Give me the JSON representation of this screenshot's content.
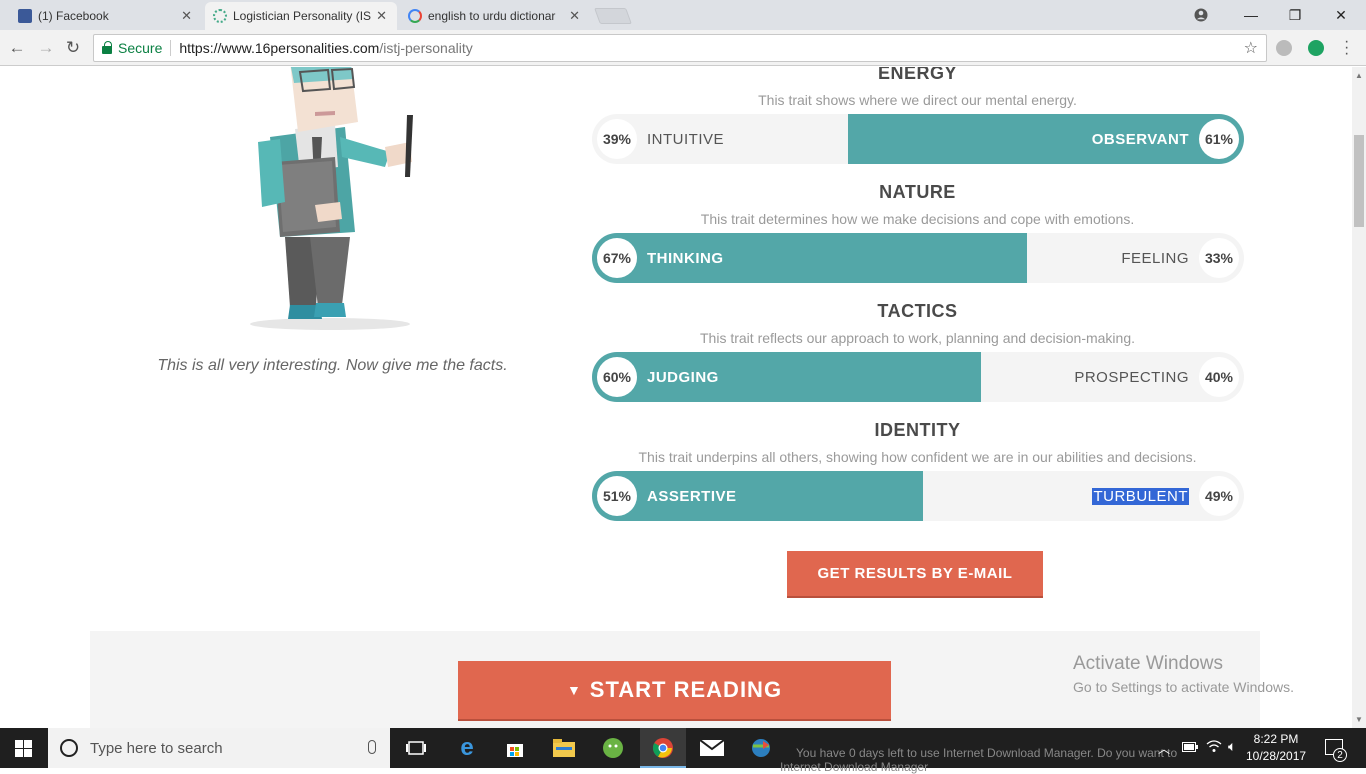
{
  "browser": {
    "tabs": [
      {
        "label": "(1) Facebook",
        "close": "✕"
      },
      {
        "label": "Logistician Personality (IS",
        "close": "✕"
      },
      {
        "label": "english to urdu dictionar",
        "close": "✕"
      }
    ],
    "window_controls": {
      "minimize": "—",
      "restore": "❐",
      "close": "✕"
    },
    "back": "←",
    "forward": "→",
    "reload": "↻",
    "secure_label": "Secure",
    "url_host": "https://www.16personalities.com",
    "url_path": "/istj-personality",
    "star": "☆",
    "colors": {
      "tab_strip": "#dee1e6",
      "secure": "#0b8043"
    }
  },
  "page": {
    "caption": "This is all very interesting. Now give me the facts.",
    "traits": [
      {
        "title": "ENERGY",
        "desc": "This trait shows where we direct our mental energy.",
        "left_label": "INTUITIVE",
        "left_pct": "39%",
        "right_label": "OBSERVANT",
        "right_pct": "61%",
        "dominant": "right",
        "value": 0.61
      },
      {
        "title": "NATURE",
        "desc": "This trait determines how we make decisions and cope with emotions.",
        "left_label": "THINKING",
        "left_pct": "67%",
        "right_label": "FEELING",
        "right_pct": "33%",
        "dominant": "left",
        "value": 0.67
      },
      {
        "title": "TACTICS",
        "desc": "This trait reflects our approach to work, planning and decision-making.",
        "left_label": "JUDGING",
        "left_pct": "60%",
        "right_label": "PROSPECTING",
        "right_pct": "40%",
        "dominant": "left",
        "value": 0.6
      },
      {
        "title": "IDENTITY",
        "desc": "This trait underpins all others, showing how confident we are in our abilities and decisions.",
        "left_label": "ASSERTIVE",
        "left_pct": "51%",
        "right_label": "TURBULENT",
        "right_pct": "49%",
        "dominant": "left",
        "value": 0.51
      }
    ],
    "email_button": "GET RESULTS BY E-MAIL",
    "start_button": "START READING",
    "start_caret": "▼",
    "colors": {
      "teal": "#53a7a8",
      "accent": "#e0674f",
      "bar_bg": "#f4f4f4"
    }
  },
  "watermark": {
    "line1": "Activate Windows",
    "line2": "Go to Settings to activate Windows."
  },
  "taskbar": {
    "search_placeholder": "Type here to search",
    "notice_line1": "You have 0 days left to use Internet Download Manager. Do you want to",
    "notice_line2": "Internet Download Manager",
    "time": "8:22 PM",
    "date": "10/28/2017",
    "notification_count": "2",
    "icons": [
      "task-view-icon",
      "edge-icon",
      "store-icon",
      "file-explorer-icon",
      "android-studio-icon",
      "chrome-icon",
      "mail-icon",
      "idm-icon"
    ]
  }
}
